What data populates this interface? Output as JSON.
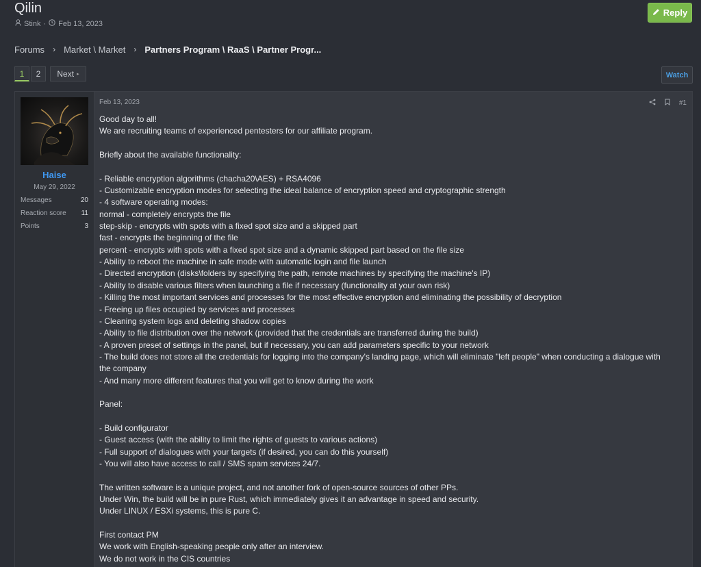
{
  "thread": {
    "title": "Qilin",
    "author": "Stink",
    "date": "Feb 13, 2023"
  },
  "actions": {
    "reply_label": "Reply",
    "watch_label": "Watch"
  },
  "breadcrumb": {
    "items": [
      "Forums",
      "Market \\ Market"
    ],
    "current": "Partners Program \\ RaaS \\ Partner Progr..."
  },
  "pagination": {
    "pages": [
      "1",
      "2"
    ],
    "next_label": "Next"
  },
  "post": {
    "user": {
      "name": "Haise",
      "joined": "May 29, 2022",
      "stats": [
        {
          "label": "Messages",
          "value": "20"
        },
        {
          "label": "Reaction score",
          "value": "11"
        },
        {
          "label": "Points",
          "value": "3"
        }
      ]
    },
    "date": "Feb 13, 2023",
    "number": "#1",
    "lines": [
      "Good day to all!",
      "We are recruiting teams of experienced pentesters for our affiliate program.",
      "",
      "Briefly about the available functionality:",
      "",
      "- Reliable encryption algorithms (chacha20\\AES) + RSA4096",
      "- Customizable encryption modes for selecting the ideal balance of encryption speed and cryptographic strength",
      "- 4 software operating modes:",
      "normal - completely encrypts the file",
      "step-skip - encrypts with spots with a fixed spot size and a skipped part",
      "fast - encrypts the beginning of the file",
      "percent - encrypts with spots with a fixed spot size and a dynamic skipped part based on the file size",
      "- Ability to reboot the machine in safe mode with automatic login and file launch",
      "- Directed encryption (disks\\folders by specifying the path, remote machines by specifying the machine's IP)",
      "- Ability to disable various filters when launching a file if necessary (functionality at your own risk)",
      "- Killing the most important services and processes for the most effective encryption and eliminating the possibility of decryption",
      "- Freeing up files occupied by services and processes",
      "- Cleaning system logs and deleting shadow copies",
      "- Ability to file distribution over the network (provided that the credentials are transferred during the build)",
      "- A proven preset of settings in the panel, but if necessary, you can add parameters specific to your network",
      "- The build does not store all the credentials for logging into the company's landing page, which will eliminate \"left people\" when conducting a dialogue with",
      "the company",
      "- And many more different features that you will get to know during the work",
      "",
      "Panel:",
      "",
      "- Build configurator",
      "- Guest access (with the ability to limit the rights of guests to various actions)",
      "- Full support of dialogues with your targets (if desired, you can do this yourself)",
      "- You will also have access to call / SMS spam services 24/7.",
      "",
      "The written software is a unique project, and not another fork of open-source sources of other PPs.",
      "Under Win, the build will be in pure Rust, which immediately gives it an advantage in speed and security.",
      "Under LINUX / ESXi systems, this is pure C.",
      "",
      "First contact PM",
      "We work with English-speaking people only after an interview.",
      "We do not work in the CIS countries"
    ]
  },
  "colors": {
    "accent_green": "#7ab94b",
    "link_blue": "#3f97f0",
    "background": "#2b2e35"
  },
  "icons": [
    "user-icon",
    "clock-icon",
    "pencil-icon",
    "chevron-right-icon",
    "share-icon",
    "bookmark-icon"
  ]
}
